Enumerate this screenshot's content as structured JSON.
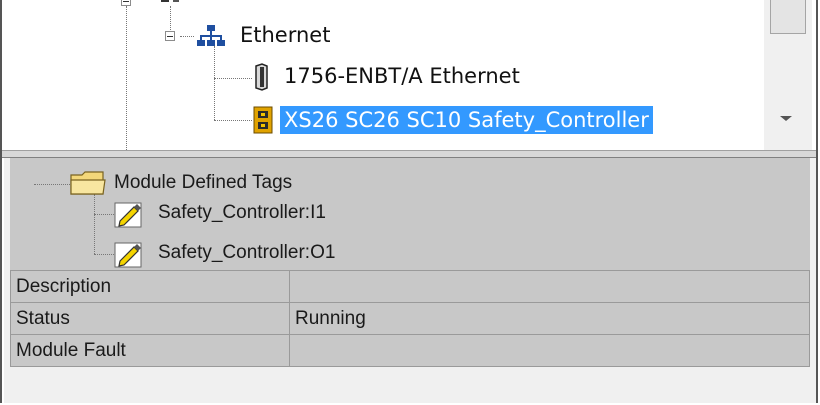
{
  "tree": {
    "ethernet_label": "Ethernet",
    "items": [
      {
        "label": "1756-ENBT/A Ethernet",
        "icon": "ethernet-module-icon"
      },
      {
        "label": "XS26 SC26 SC10 Safety_Controller",
        "icon": "safety-controller-icon",
        "selected": true
      }
    ],
    "selection_color": "#3399ff"
  },
  "tags": {
    "folder_label": "Module Defined Tags",
    "items": [
      {
        "label": "Safety_Controller:I1",
        "icon": "tag-pencil-icon"
      },
      {
        "label": "Safety_Controller:O1",
        "icon": "tag-pencil-icon"
      }
    ]
  },
  "properties": {
    "rows": [
      {
        "name": "Description",
        "value": ""
      },
      {
        "name": "Status",
        "value": "Running"
      },
      {
        "name": "Module Fault",
        "value": ""
      }
    ]
  }
}
